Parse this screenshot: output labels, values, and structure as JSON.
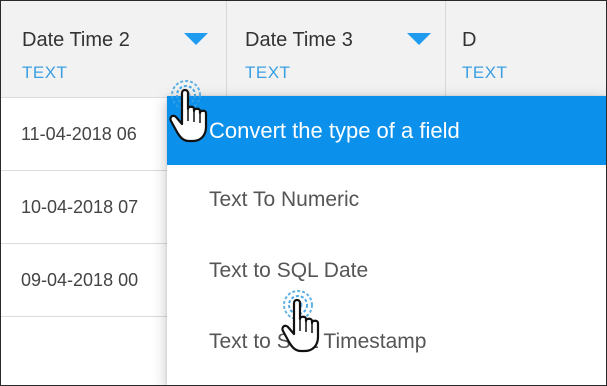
{
  "columns": [
    {
      "name": "Date Time 2",
      "type": "TEXT",
      "has_menu": true
    },
    {
      "name": "Date Time 3",
      "type": "TEXT",
      "has_menu": true
    },
    {
      "name": "D",
      "type": "TEXT",
      "has_menu": false
    }
  ],
  "rows": [
    {
      "date_time_2": "11-04-2018 06"
    },
    {
      "date_time_2": "10-04-2018 07"
    },
    {
      "date_time_2": "09-04-2018 00"
    }
  ],
  "dropdown": {
    "title": "Convert the type of a field",
    "items": [
      {
        "label": "Text To Numeric"
      },
      {
        "label": "Text to SQL Date"
      },
      {
        "label": "Text to SQL Timestamp"
      }
    ]
  },
  "colors": {
    "accent": "#0b90ec",
    "type_label": "#3aa0e2",
    "header_bg": "#f2f2f2"
  },
  "icons": {
    "column_menu": "chevron-down-icon",
    "pointer": "hand-pointer-icon"
  }
}
